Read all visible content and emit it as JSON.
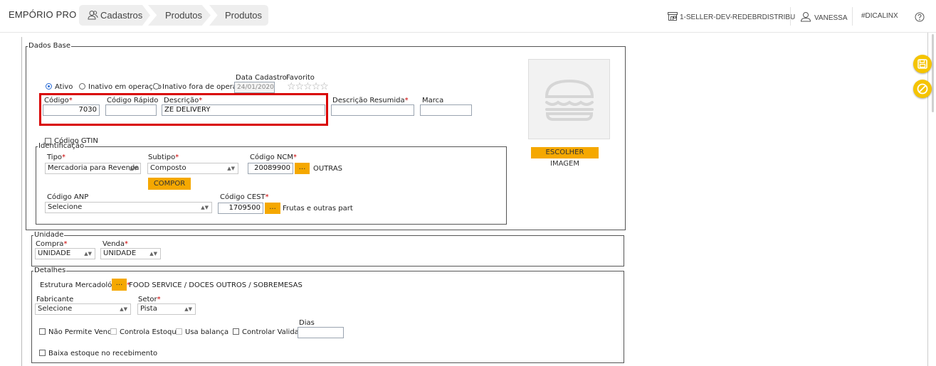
{
  "app": {
    "title": "EMPÓRIO PRO"
  },
  "breadcrumb": [
    "Cadastros",
    "Produtos",
    "Produtos"
  ],
  "topbar": {
    "store": "1-SELLER-DEV-REDEBRDISTRIBU",
    "user": "VANESSA",
    "hashtag": "#DICALINX"
  },
  "dados_base": {
    "legend": "Dados Base",
    "status_options": [
      {
        "label": "Ativo",
        "checked": true
      },
      {
        "label": "Inativo em operação",
        "checked": false
      },
      {
        "label": "Inativo fora de operação",
        "checked": false
      }
    ],
    "data_cadastro": {
      "label": "Data Cadastro",
      "value": "24/01/2020"
    },
    "favorito": {
      "label": "Favorito",
      "stars": 0,
      "max": 5
    },
    "codigo": {
      "label": "Código",
      "value": "7030"
    },
    "codigo_rapido": {
      "label": "Código Rápido",
      "value": ""
    },
    "descricao": {
      "label": "Descrição",
      "value": "ZE DELIVERY"
    },
    "descricao_resumida": {
      "label": "Descrição Resumida",
      "value": ""
    },
    "marca": {
      "label": "Marca",
      "value": ""
    },
    "codigo_gtin": {
      "label": "Código GTIN"
    },
    "escolher_imagem": "ESCOLHER IMAGEM"
  },
  "identificacao": {
    "legend": "Identificação",
    "tipo": {
      "label": "Tipo",
      "value": "Mercadoria para Revenda"
    },
    "subtipo": {
      "label": "Subtipo",
      "value": "Composto"
    },
    "compor": "COMPOR",
    "ncm": {
      "label": "Código NCM",
      "value": "20089900",
      "btn": "...",
      "desc": "OUTRAS"
    },
    "anp": {
      "label": "Código ANP",
      "value": "Selecione"
    },
    "cest": {
      "label": "Código CEST",
      "value": "1709500",
      "btn": "...",
      "desc": "Frutas e outras part"
    }
  },
  "unidade": {
    "legend": "Unidade",
    "compra": {
      "label": "Compra",
      "value": "UNIDADE"
    },
    "venda": {
      "label": "Venda",
      "value": "UNIDADE"
    }
  },
  "detalhes": {
    "legend": "Detalhes",
    "estrutura": {
      "label": "Estrutura Mercadológica",
      "btn": "...",
      "value": "FOOD SERVICE / DOCES OUTROS / SOBREMESAS"
    },
    "fabricante": {
      "label": "Fabricante",
      "value": "Selecione"
    },
    "setor": {
      "label": "Setor",
      "value": "Pista"
    },
    "dias": {
      "label": "Dias",
      "value": ""
    },
    "checks": [
      {
        "label": "Não Permite Venda",
        "enabled": true
      },
      {
        "label": "Controla Estoque",
        "enabled": false
      },
      {
        "label": "Usa balança",
        "enabled": false
      },
      {
        "label": "Controlar Validade",
        "enabled": true
      }
    ],
    "baixa_estoque": "Baixa estoque no recebimento"
  },
  "colors": {
    "accent": "#f5a800",
    "side_button": "#f5c400",
    "highlight": "#d90000"
  }
}
